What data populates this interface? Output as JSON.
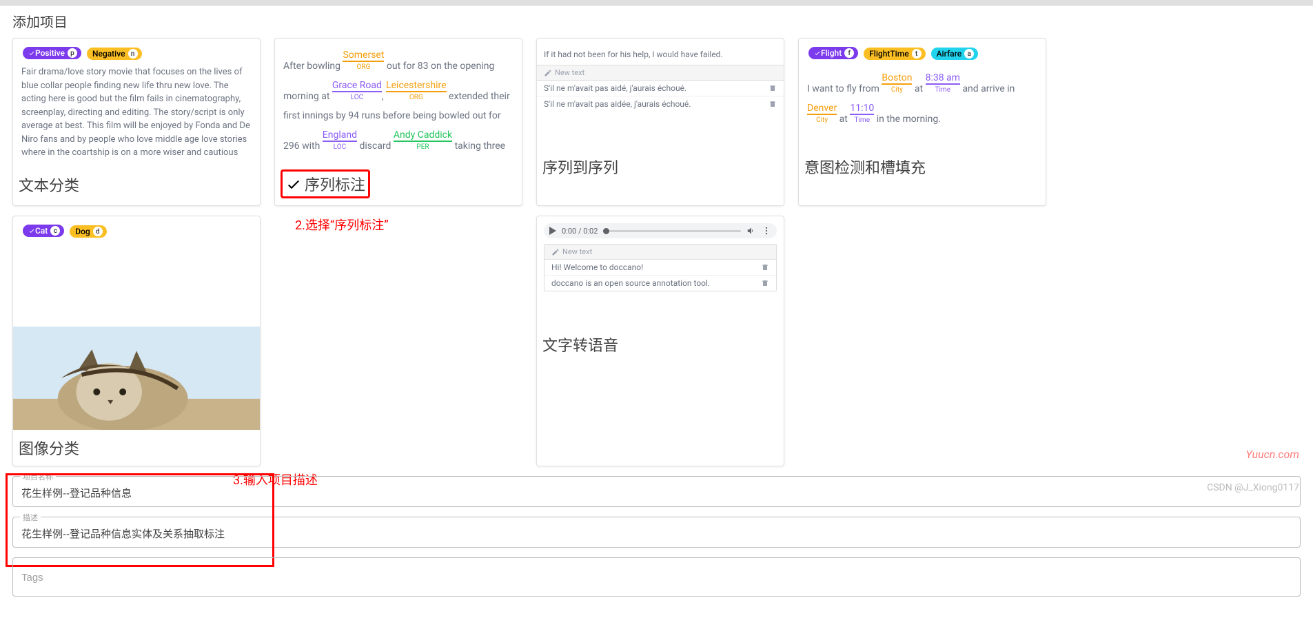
{
  "page_title": "添加项目",
  "annotations": {
    "step2": "2.选择“序列标注”",
    "step3": "3.输入项目描述"
  },
  "cards": {
    "text_classification": {
      "title": "文本分类",
      "tags": [
        {
          "label": "Positive",
          "key": "p",
          "cls": "purple",
          "check": true
        },
        {
          "label": "Negative",
          "key": "n",
          "cls": "orange"
        }
      ],
      "body": "Fair drama/love story movie that focuses on the lives of blue collar people finding new life thru new love. The acting here is good but the film fails in cinematography, screenplay, directing and editing. The story/script is only average at best. This film will be enjoyed by Fonda and De Niro fans and by people who love middle age love stories where in the coartship is on a more wiser and cautious"
    },
    "sequence_labeling": {
      "title": "序列标注",
      "text1a": "After bowling ",
      "ent1": "Somerset",
      "lab1": "ORG",
      "text1b": " out for 83 on the opening",
      "text2a": "morning at ",
      "ent2": "Grace Road",
      "lab2": "LOC",
      "text2b": ", ",
      "ent3": "Leicestershire",
      "lab3": "ORG",
      "text2c": " extended their",
      "text3": "first innings by 94 runs before being bowled out for",
      "text4a": "296 with ",
      "ent4": "England",
      "lab4": "LOC",
      "text4b": " discard ",
      "ent5": "Andy Caddick",
      "lab5": "PER",
      "text4c": " taking three"
    },
    "seq2seq": {
      "title": "序列到序列",
      "source": "If it had not been for his help, I would have failed.",
      "new_text": "New text",
      "items": [
        "S'il ne m'avait pas aidé, j'aurais échoué.",
        "S'il ne m'avait pas aidée, j'aurais échoué."
      ]
    },
    "intent": {
      "title": "意图检测和槽填充",
      "tags": [
        {
          "label": "Flight",
          "key": "f",
          "cls": "purple",
          "check": true
        },
        {
          "label": "FlightTime",
          "key": "t",
          "cls": "orange"
        },
        {
          "label": "Airfare",
          "key": "a",
          "cls": "blue"
        }
      ],
      "t1a": "I want to fly from ",
      "e1": "Boston",
      "l1": "City",
      "t1b": " at ",
      "e2": "8:38 am",
      "l2": "Time",
      "t1c": " and arrive in",
      "e3": "Denver",
      "l3": "City",
      "t2a": " at ",
      "e4": "11:10",
      "l4": "Time",
      "t2b": " in the morning."
    },
    "image_classification": {
      "title": "图像分类",
      "tags": [
        {
          "label": "Cat",
          "key": "c",
          "cls": "purple",
          "check": true
        },
        {
          "label": "Dog",
          "key": "d",
          "cls": "orange"
        }
      ]
    },
    "speech2text": {
      "title": "文字转语音",
      "time": "0:00 / 0:02",
      "new_text": "New text",
      "items": [
        "Hi! Welcome to doccano!",
        "doccano is an open source annotation tool."
      ]
    }
  },
  "form": {
    "name_label": "项目名称",
    "name_value": "花生样例--登记品种信息",
    "desc_label": "描述",
    "desc_value": "花生样例--登记品种信息实体及关系抽取标注",
    "tags_label": "Tags"
  },
  "watermarks": {
    "w1": "Yuucn.com",
    "w2": "CSDN @J_Xiong0117"
  }
}
